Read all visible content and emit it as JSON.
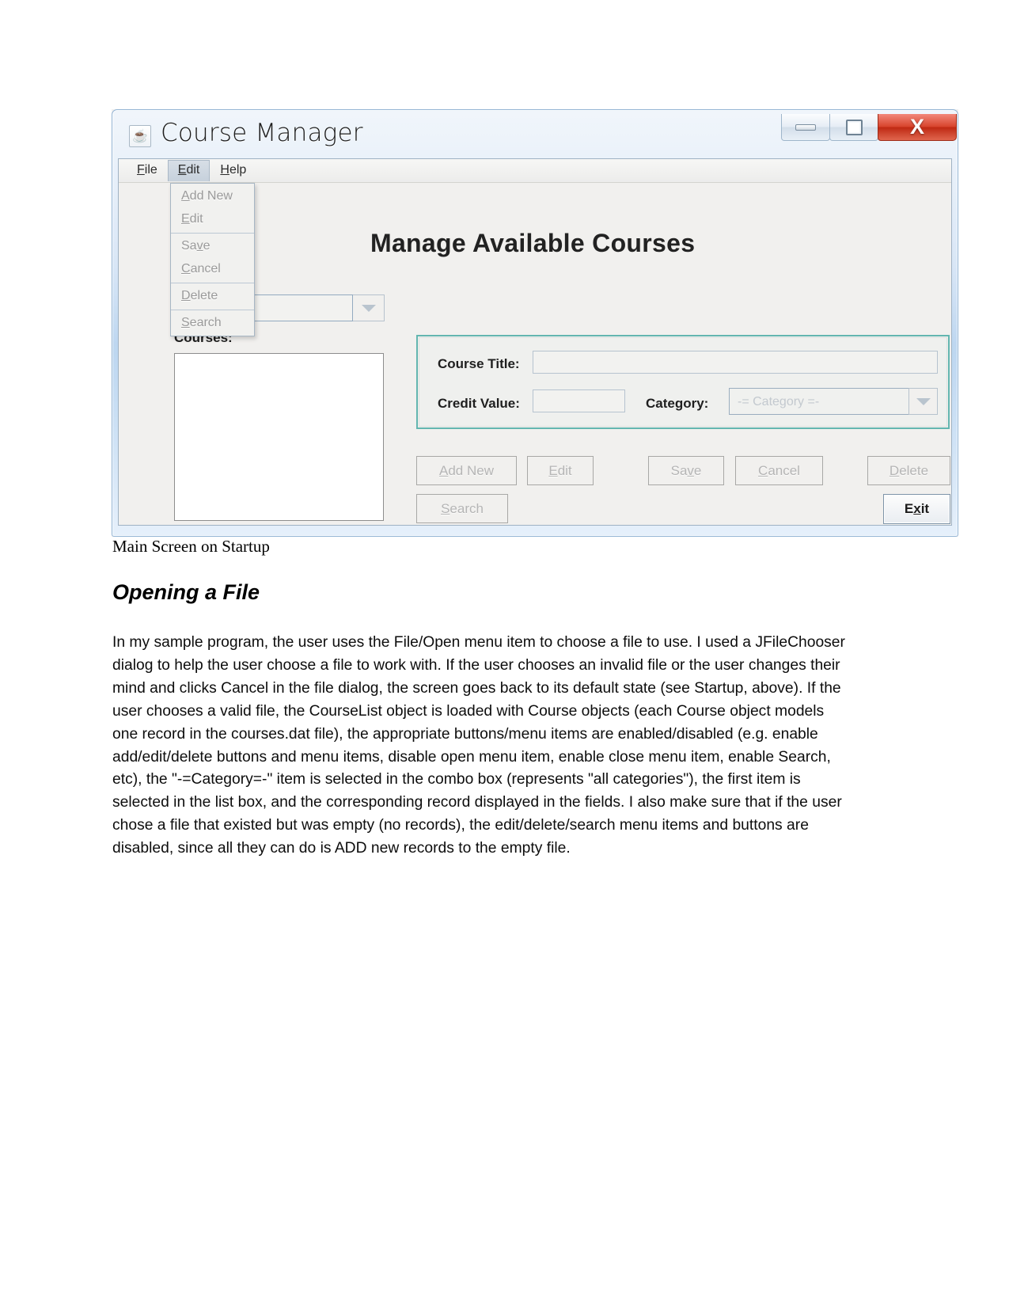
{
  "app": {
    "title": "Course Manager",
    "icon": "java-coffee-cup-icon",
    "window_controls": {
      "minimize": "–",
      "maximize": "❐",
      "close": "X"
    },
    "menubar": [
      {
        "label": "File",
        "mnemonic": "F",
        "active": false
      },
      {
        "label": "Edit",
        "mnemonic": "E",
        "active": true
      },
      {
        "label": "Help",
        "mnemonic": "H",
        "active": false
      }
    ],
    "edit_menu": {
      "open": true,
      "groups": [
        [
          {
            "label": "Add New",
            "mnemonic": "A",
            "enabled": false
          },
          {
            "label": "Edit",
            "mnemonic": "E",
            "enabled": false
          }
        ],
        [
          {
            "label": "Save",
            "mnemonic": "v",
            "enabled": false
          },
          {
            "label": "Cancel",
            "mnemonic": "C",
            "enabled": false
          }
        ],
        [
          {
            "label": "Delete",
            "mnemonic": "D",
            "enabled": false
          }
        ],
        [
          {
            "label": "Search",
            "mnemonic": "S",
            "enabled": false
          }
        ]
      ]
    },
    "panel_title": "Manage Available Courses",
    "filter_combo": {
      "value": "=-",
      "name": "category-filter-combo"
    },
    "courses_label": "Courses:",
    "courses_list": {
      "items": []
    },
    "details": {
      "course_title_label": "Course Title:",
      "course_title_value": "",
      "credit_value_label": "Credit Value:",
      "credit_value_value": "",
      "category_label": "Category:",
      "category_value": "-= Category =-",
      "border_color": "#63b6b0"
    },
    "buttons": [
      {
        "label": "Add New",
        "mnemonic": "A",
        "enabled": false,
        "name": "add-new-button"
      },
      {
        "label": "Edit",
        "mnemonic": "E",
        "enabled": false,
        "name": "edit-button"
      },
      {
        "label": "Save",
        "mnemonic": "v",
        "enabled": false,
        "name": "save-button"
      },
      {
        "label": "Cancel",
        "mnemonic": "C",
        "enabled": false,
        "name": "cancel-button"
      },
      {
        "label": "Delete",
        "mnemonic": "D",
        "enabled": false,
        "name": "delete-button"
      },
      {
        "label": "Search",
        "mnemonic": "S",
        "enabled": false,
        "name": "search-button"
      },
      {
        "label": "Exit",
        "mnemonic": "x",
        "enabled": true,
        "name": "exit-button"
      }
    ]
  },
  "document": {
    "caption": "Main Screen on Startup",
    "heading": "Opening a File",
    "paragraph": "In my sample program, the user uses the File/Open menu item to choose a file to use. I used a JFileChooser dialog to help the user choose a file to work with. If the user chooses an invalid file or the user changes their mind and clicks Cancel in the file dialog, the screen goes back to its default state (see Startup, above). If the user chooses a valid file, the CourseList object is loaded with Course objects (each Course object models one record in the courses.dat file), the appropriate buttons/menu items are enabled/disabled (e.g. enable add/edit/delete buttons and menu items, disable open menu item, enable close menu item, enable Search, etc), the \"-=Category=-\" item is selected in the combo box (represents \"all categories\"), the first item is selected in the list box, and the corresponding record displayed in the fields. I also make sure that if the user chose a file that existed but was empty (no records), the edit/delete/search menu items and buttons are disabled, since all they can do is ADD new records to the empty file."
  }
}
